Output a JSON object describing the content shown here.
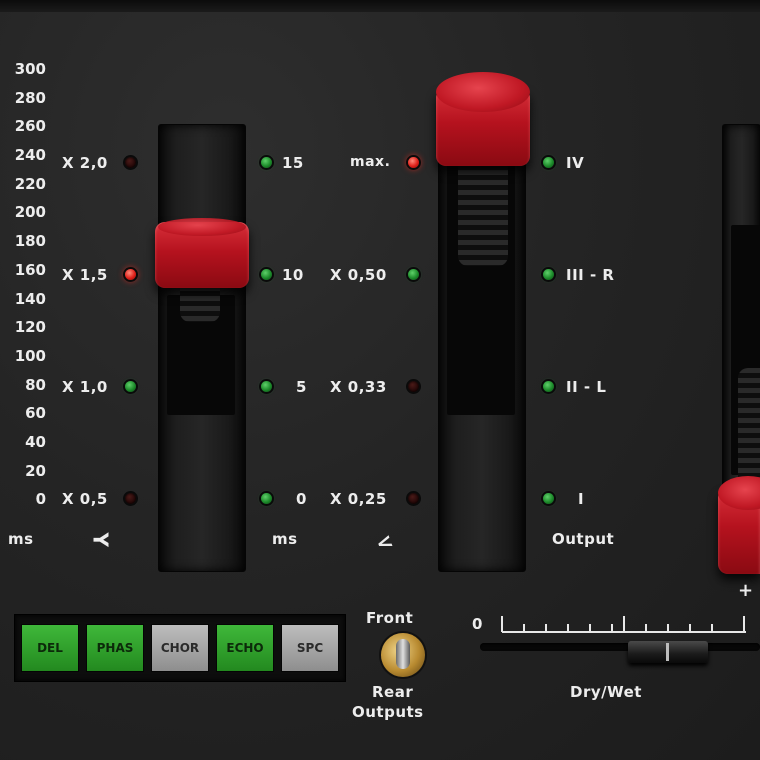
{
  "delay_scale": [
    "300",
    "280",
    "260",
    "240",
    "220",
    "200",
    "180",
    "160",
    "140",
    "120",
    "100",
    "80",
    "60",
    "40",
    "20",
    "0"
  ],
  "delay_unit": "ms",
  "multiplier": {
    "values": [
      "X 2,0",
      "X 1,5",
      "X 1,0",
      "X 0,5"
    ],
    "symbol": "Y",
    "led_states": [
      "dark",
      "red",
      "green",
      "dark"
    ]
  },
  "time_scale": {
    "values": [
      "15",
      "10",
      "5",
      "0"
    ],
    "unit": "ms",
    "led_states": [
      "green",
      "green",
      "green",
      "green"
    ]
  },
  "feedback": {
    "values": [
      "max.",
      "X 0,50",
      "X 0,33",
      "X 0,25"
    ],
    "symbol": "<",
    "led_states": [
      "red",
      "green",
      "dark",
      "dark"
    ]
  },
  "output": {
    "values": [
      "IV",
      "III - R",
      "II - L",
      "I"
    ],
    "label": "Output",
    "led_states": [
      "green",
      "green",
      "green",
      "green"
    ]
  },
  "effect_buttons": [
    {
      "label": "DEL",
      "active": true
    },
    {
      "label": "PHAS",
      "active": true
    },
    {
      "label": "CHOR",
      "active": false
    },
    {
      "label": "ECHO",
      "active": true
    },
    {
      "label": "SPC",
      "active": false
    }
  ],
  "toggle": {
    "top_label": "Front",
    "bottom_label_1": "Rear",
    "bottom_label_2": "Outputs"
  },
  "mix": {
    "zero_label": "0",
    "label": "Dry/Wet",
    "value_fraction": 0.67
  },
  "edge_label": "+",
  "colors": {
    "led_red": "#e0201a",
    "led_green": "#1c8a2a",
    "cap_red": "#b5121e",
    "button_green": "#3fb83a",
    "button_grey": "#bdbdbd"
  }
}
